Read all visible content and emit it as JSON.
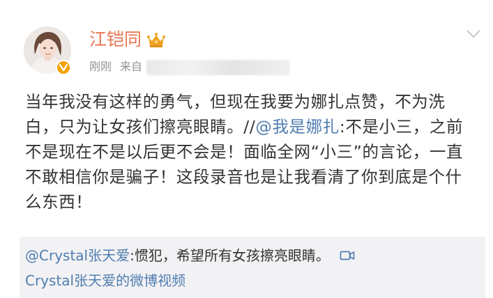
{
  "post": {
    "author": {
      "name": "江铠同"
    },
    "meta": {
      "time": "刚刚",
      "source_prefix": "来自"
    },
    "content": {
      "text_part1": "当年我没有这样的勇气，但现在我要为娜扎点赞，不为洗白，只为让女孩们擦亮眼睛。//",
      "mention": "@我是娜扎",
      "text_part2": ":不是小三，之前不是现在不是以后更不会是！面临全网“小三”的言论，一直不敢相信你是骗子！这段录音也是让我看清了你到底是个什么东西！"
    },
    "quote": {
      "mention": "@Crystal张天爱",
      "text": ":惯犯，希望所有女孩擦亮眼睛。",
      "video_link": "Crystal张天爱的微博视频"
    }
  },
  "colors": {
    "username": "#eb7350",
    "link": "#507daf",
    "meta": "#939393",
    "quote_bg": "#f2f2f5",
    "vip_badge": "#f4a200"
  },
  "icons": [
    "avatar",
    "vip-badge-icon",
    "crown-icon",
    "chevron-down-icon",
    "video-icon"
  ]
}
